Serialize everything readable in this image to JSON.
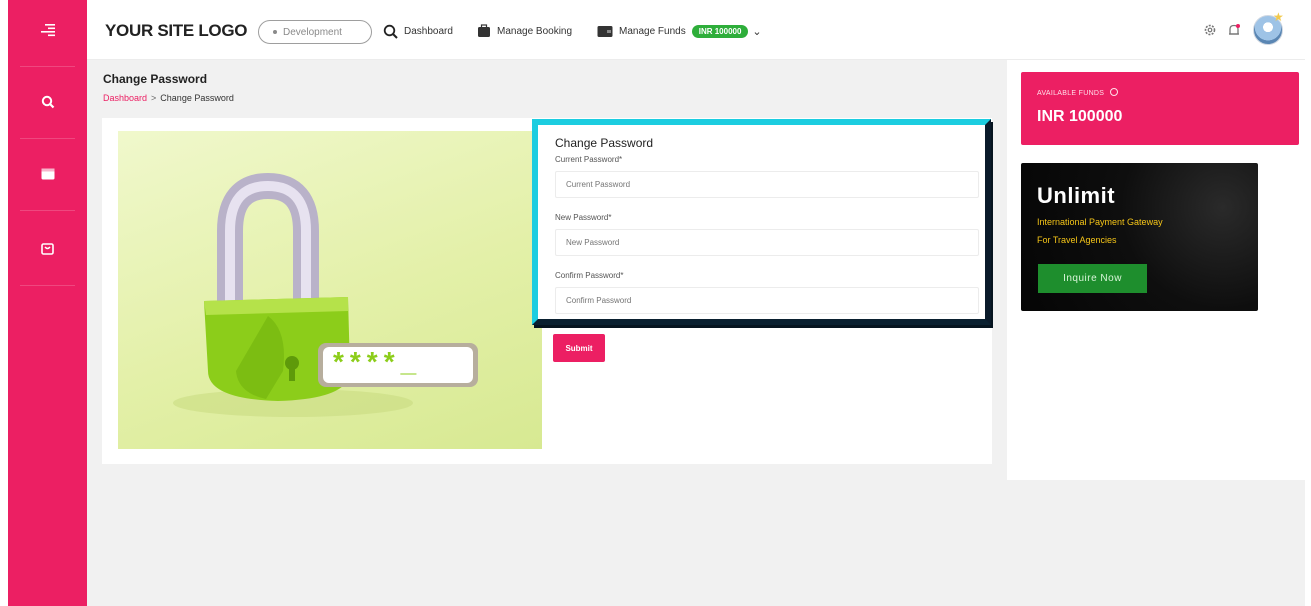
{
  "app": {
    "logo": "YOUR SITE LOGO",
    "environment": "Development"
  },
  "nav": {
    "dashboard": "Dashboard",
    "manage_booking": "Manage Booking",
    "manage_funds": "Manage Funds",
    "funds_badge": "INR 100000"
  },
  "page": {
    "title": "Change Password",
    "breadcrumb": {
      "root": "Dashboard",
      "separator": ">",
      "current": "Change Password"
    }
  },
  "form": {
    "title": "Change Password",
    "current_label": "Current Password*",
    "current_placeholder": "Current Password",
    "new_label": "New Password*",
    "new_placeholder": "New Password",
    "confirm_label": "Confirm Password*",
    "confirm_placeholder": "Confirm Password",
    "submit": "Submit"
  },
  "hero": {
    "masked_text": "****_"
  },
  "sidebar_panel": {
    "funds_label": "AVAILABLE FUNDS",
    "funds_value": "INR 100000",
    "promo_brand": "Unlimit",
    "promo_line1": "International Payment Gateway",
    "promo_line2": "For Travel Agencies",
    "promo_button": "Inquire Now"
  },
  "icons": [
    "menu-icon",
    "search-icon",
    "window-icon",
    "bag-icon",
    "magnifier-icon",
    "briefcase-icon",
    "wallet-icon",
    "chevron-down-icon",
    "settings-icon",
    "bell-icon",
    "info-icon"
  ],
  "colors": {
    "accent": "#ec1f63",
    "highlight_border": "#1ccde0",
    "success": "#2eae3a"
  }
}
